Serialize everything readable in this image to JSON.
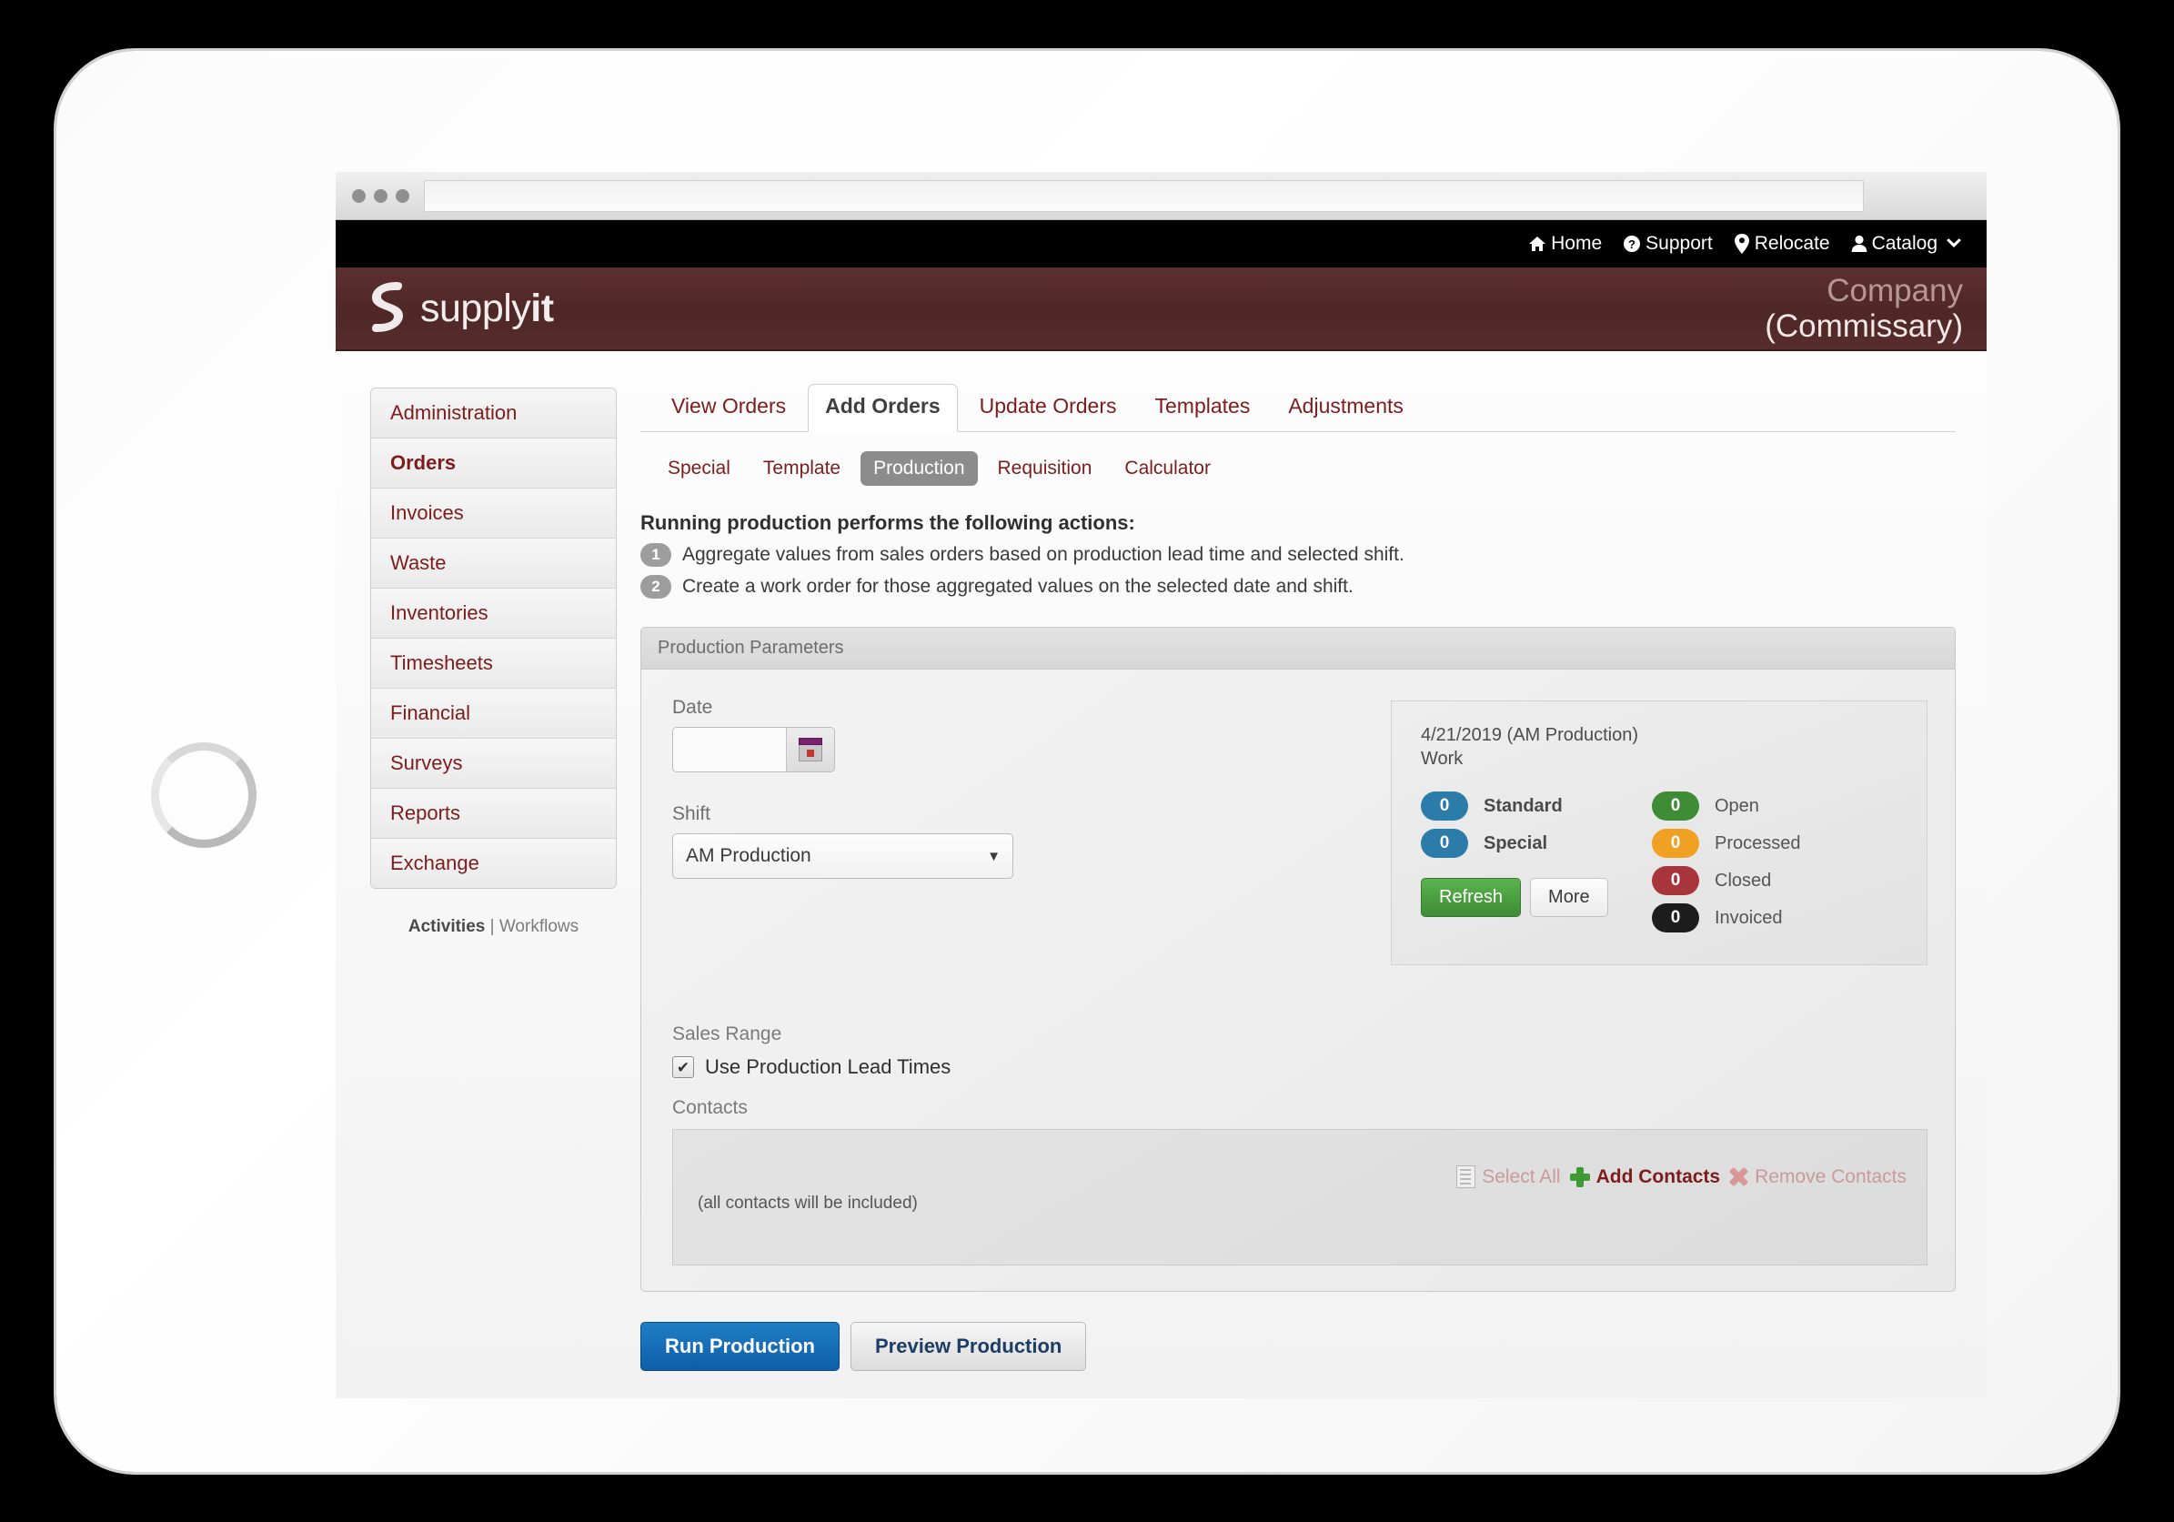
{
  "browser": {
    "address_value": "",
    "address_placeholder": ""
  },
  "topnav": {
    "items": [
      {
        "label": "Home",
        "icon": "home-icon"
      },
      {
        "label": "Support",
        "icon": "question-circle-icon"
      },
      {
        "label": "Relocate",
        "icon": "map-pin-icon"
      },
      {
        "label": "Catalog",
        "icon": "user-icon"
      }
    ],
    "caret": "⌄"
  },
  "brand": {
    "name_light": "supply",
    "name_bold": "it",
    "company": "Company",
    "company_sub": "(Commissary)"
  },
  "sidebar": {
    "items": [
      {
        "label": "Administration",
        "active": false
      },
      {
        "label": "Orders",
        "active": true
      },
      {
        "label": "Invoices",
        "active": false
      },
      {
        "label": "Waste",
        "active": false
      },
      {
        "label": "Inventories",
        "active": false
      },
      {
        "label": "Timesheets",
        "active": false
      },
      {
        "label": "Financial",
        "active": false
      },
      {
        "label": "Surveys",
        "active": false
      },
      {
        "label": "Reports",
        "active": false
      },
      {
        "label": "Exchange",
        "active": false
      }
    ],
    "footer": {
      "activities": "Activities",
      "separator": "|",
      "workflows": "Workflows"
    }
  },
  "tabs": [
    {
      "label": "View Orders",
      "active": false
    },
    {
      "label": "Add Orders",
      "active": true
    },
    {
      "label": "Update Orders",
      "active": false
    },
    {
      "label": "Templates",
      "active": false
    },
    {
      "label": "Adjustments",
      "active": false
    }
  ],
  "subtabs": [
    {
      "label": "Special",
      "active": false
    },
    {
      "label": "Template",
      "active": false
    },
    {
      "label": "Production",
      "active": true
    },
    {
      "label": "Requisition",
      "active": false
    },
    {
      "label": "Calculator",
      "active": false
    }
  ],
  "intro": {
    "title": "Running production performs the following actions:",
    "steps": [
      {
        "num": "1",
        "text": "Aggregate values from sales orders based on production lead time and selected shift."
      },
      {
        "num": "2",
        "text": "Create a work order for those aggregated values on the selected date and shift."
      }
    ]
  },
  "panel": {
    "title": "Production Parameters",
    "date": {
      "label": "Date",
      "value": "",
      "placeholder": "",
      "picker_icon": "calendar-icon"
    },
    "shift": {
      "label": "Shift",
      "value": "AM Production",
      "options": [
        "AM Production"
      ],
      "caret": "▼"
    },
    "sales_range": {
      "label": "Sales Range",
      "checkbox_label": "Use Production Lead Times",
      "checked": true,
      "check_glyph": "✔"
    },
    "contacts": {
      "label": "Contacts",
      "note": "(all contacts will be included)",
      "toolbar": [
        {
          "label": "Select All",
          "icon": "checklist-icon",
          "enabled": false
        },
        {
          "label": "Add Contacts",
          "icon": "plus-icon",
          "enabled": true
        },
        {
          "label": "Remove Contacts",
          "icon": "remove-x-icon",
          "enabled": false
        }
      ]
    }
  },
  "status_card": {
    "date_line": "4/21/2019 (AM Production)",
    "sub_line": "Work",
    "left_stats": [
      {
        "count": "0",
        "label": "Standard",
        "color": "#2b7ca8"
      },
      {
        "count": "0",
        "label": "Special",
        "color": "#2b7ca8"
      }
    ],
    "right_stats": [
      {
        "count": "0",
        "label": "Open",
        "color": "#3f8c36"
      },
      {
        "count": "0",
        "label": "Processed",
        "color": "#f0a022"
      },
      {
        "count": "0",
        "label": "Closed",
        "color": "#a8343c"
      },
      {
        "count": "0",
        "label": "Invoiced",
        "color": "#1d1d1d"
      }
    ],
    "refresh_label": "Refresh",
    "more_label": "More"
  },
  "actions": {
    "run_label": "Run Production",
    "preview_label": "Preview Production"
  },
  "colors": {
    "brand_maroon": "#4f2727",
    "link_red": "#7d1c1c",
    "primary_blue": "#1f7fc4",
    "success_green": "#3f8c36"
  }
}
